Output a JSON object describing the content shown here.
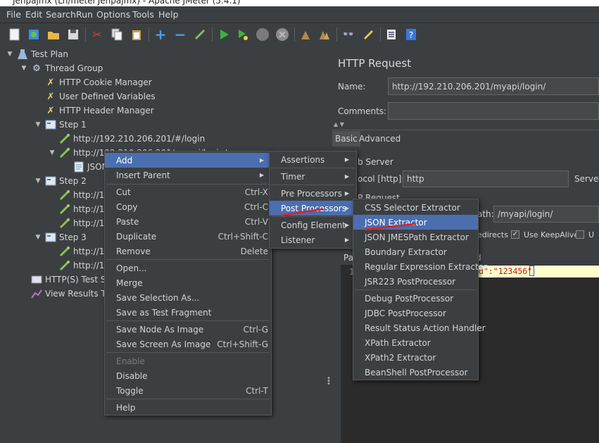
{
  "window": {
    "title": "Jenpajmx (Ln/metel Jenpajmx) - Apache JMeter (5.4.1)"
  },
  "menubar": [
    "File",
    "Edit",
    "Search",
    "Run",
    "Options",
    "Tools",
    "Help"
  ],
  "tree": {
    "nodes": [
      {
        "label": "Test Plan",
        "icon": "test-plan-icon"
      },
      {
        "label": "Thread Group",
        "icon": "gear-icon"
      },
      {
        "label": "HTTP Cookie Manager",
        "icon": "wrench-icon"
      },
      {
        "label": "User Defined Variables",
        "icon": "wrench-icon"
      },
      {
        "label": "HTTP Header Manager",
        "icon": "wrench-icon"
      },
      {
        "label": "Step 1",
        "icon": "controller-icon"
      },
      {
        "label": "http://192.210.206.201/#/login",
        "icon": "pipette-icon"
      },
      {
        "label": "http://192.210.206.201/myapi/login/",
        "icon": "pipette-icon"
      },
      {
        "label": "JSON",
        "icon": "document-icon"
      },
      {
        "label": "Step 2",
        "icon": "controller-icon"
      },
      {
        "label": "http://1",
        "icon": "pipette-icon"
      },
      {
        "label": "http://1",
        "icon": "pipette-icon"
      },
      {
        "label": "http://1",
        "icon": "pipette-icon"
      },
      {
        "label": "Step 3",
        "icon": "controller-icon"
      },
      {
        "label": "http://1",
        "icon": "pipette-icon"
      },
      {
        "label": "http://1",
        "icon": "pipette-icon"
      },
      {
        "label": "HTTP(S) Test Sc",
        "icon": "recorder-icon"
      },
      {
        "label": "View Results Tre",
        "icon": "chart-icon"
      }
    ]
  },
  "panel": {
    "title": "HTTP Request",
    "name_label": "Name:",
    "name_value": "http://192.210.206.201/myapi/login/",
    "comments_label": "Comments:",
    "tabs": [
      "Basic",
      "Advanced"
    ],
    "web_server_label": "b Server",
    "protocol_label": "ocol [http]:",
    "protocol_value": "http",
    "server_label": "Serve",
    "http_request_label": "P Request",
    "path_label": "ath:",
    "path_value": "/myapi/login/",
    "redirects_label": "edirects",
    "keepalive_label": "Use KeepAlive",
    "u_label": "U",
    "params_tab_label": "Pa",
    "body_tab_label": "d",
    "line_number": "1",
    "body_text": "d\":\"123456\""
  },
  "context_menu": {
    "items": [
      {
        "label": "Add",
        "shortcut": "",
        "submenu": true,
        "highlight": true
      },
      {
        "label": "Insert Parent",
        "shortcut": "",
        "submenu": true
      },
      {
        "label": "Cut",
        "shortcut": "Ctrl-X"
      },
      {
        "label": "Copy",
        "shortcut": "Ctrl-C"
      },
      {
        "label": "Paste",
        "shortcut": "Ctrl-V"
      },
      {
        "label": "Duplicate",
        "shortcut": "Ctrl+Shift-C"
      },
      {
        "label": "Remove",
        "shortcut": "Delete"
      },
      {
        "label": "Open...",
        "shortcut": ""
      },
      {
        "label": "Merge",
        "shortcut": ""
      },
      {
        "label": "Save Selection As...",
        "shortcut": ""
      },
      {
        "label": "Save as Test Fragment",
        "shortcut": ""
      },
      {
        "label": "Save Node As Image",
        "shortcut": "Ctrl-G"
      },
      {
        "label": "Save Screen As Image",
        "shortcut": "Ctrl+Shift-G"
      },
      {
        "label": "Enable",
        "shortcut": "",
        "disabled": true
      },
      {
        "label": "Disable",
        "shortcut": ""
      },
      {
        "label": "Toggle",
        "shortcut": "Ctrl-T"
      },
      {
        "label": "Help",
        "shortcut": ""
      }
    ]
  },
  "add_submenu": {
    "items": [
      "Assertions",
      "Timer",
      "Pre Processors",
      "Post Processors",
      "Config Element",
      "Listener"
    ]
  },
  "post_processors_submenu": {
    "items": [
      "CSS Selector Extractor",
      "JSON Extractor",
      "JSON JMESPath Extractor",
      "Boundary Extractor",
      "Regular Expression Extractor",
      "JSR223 PostProcessor",
      "Debug PostProcessor",
      "JDBC PostProcessor",
      "Result Status Action Handler",
      "XPath Extractor",
      "XPath2 Extractor",
      "BeanShell PostProcessor"
    ]
  },
  "colors": {
    "background": "#3c3f41",
    "selection": "#0d293e",
    "menu_highlight": "#4b6eaf",
    "annotation": "#e02020",
    "json_highlight": "#ffffcc"
  }
}
